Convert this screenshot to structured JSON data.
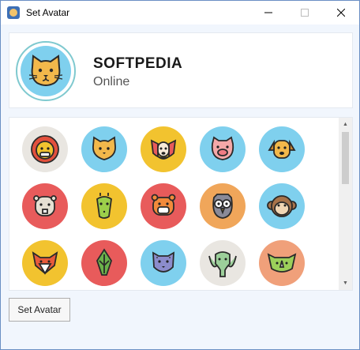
{
  "window": {
    "title": "Set Avatar",
    "icon": "avatar-app-icon"
  },
  "caption": {
    "minimize": "─",
    "maximize": "☐",
    "close": "✕"
  },
  "profile": {
    "name": "SOFTPEDIA",
    "status": "Online",
    "avatar": "cat"
  },
  "avatars": [
    {
      "name": "lion",
      "bg": "#e9e6e1"
    },
    {
      "name": "cat",
      "bg": "#7fd0ee"
    },
    {
      "name": "dog",
      "bg": "#f2c32f"
    },
    {
      "name": "pig",
      "bg": "#7fd0ee"
    },
    {
      "name": "dog-2",
      "bg": "#7fd0ee"
    },
    {
      "name": "beaver",
      "bg": "#e85b5b"
    },
    {
      "name": "giraffe",
      "bg": "#f2c32f"
    },
    {
      "name": "tiger",
      "bg": "#e85b5b"
    },
    {
      "name": "owl",
      "bg": "#f0a65a"
    },
    {
      "name": "monkey",
      "bg": "#7fd0ee"
    },
    {
      "name": "fox",
      "bg": "#f2c32f"
    },
    {
      "name": "parrot",
      "bg": "#e85b5b"
    },
    {
      "name": "leopard",
      "bg": "#7fd0ee"
    },
    {
      "name": "elephant",
      "bg": "#e9e6e1"
    },
    {
      "name": "rhino",
      "bg": "#f0a07a"
    }
  ],
  "scrollbar": {
    "up": "▲",
    "down": "▼"
  },
  "actions": {
    "set_avatar": "Set Avatar"
  }
}
